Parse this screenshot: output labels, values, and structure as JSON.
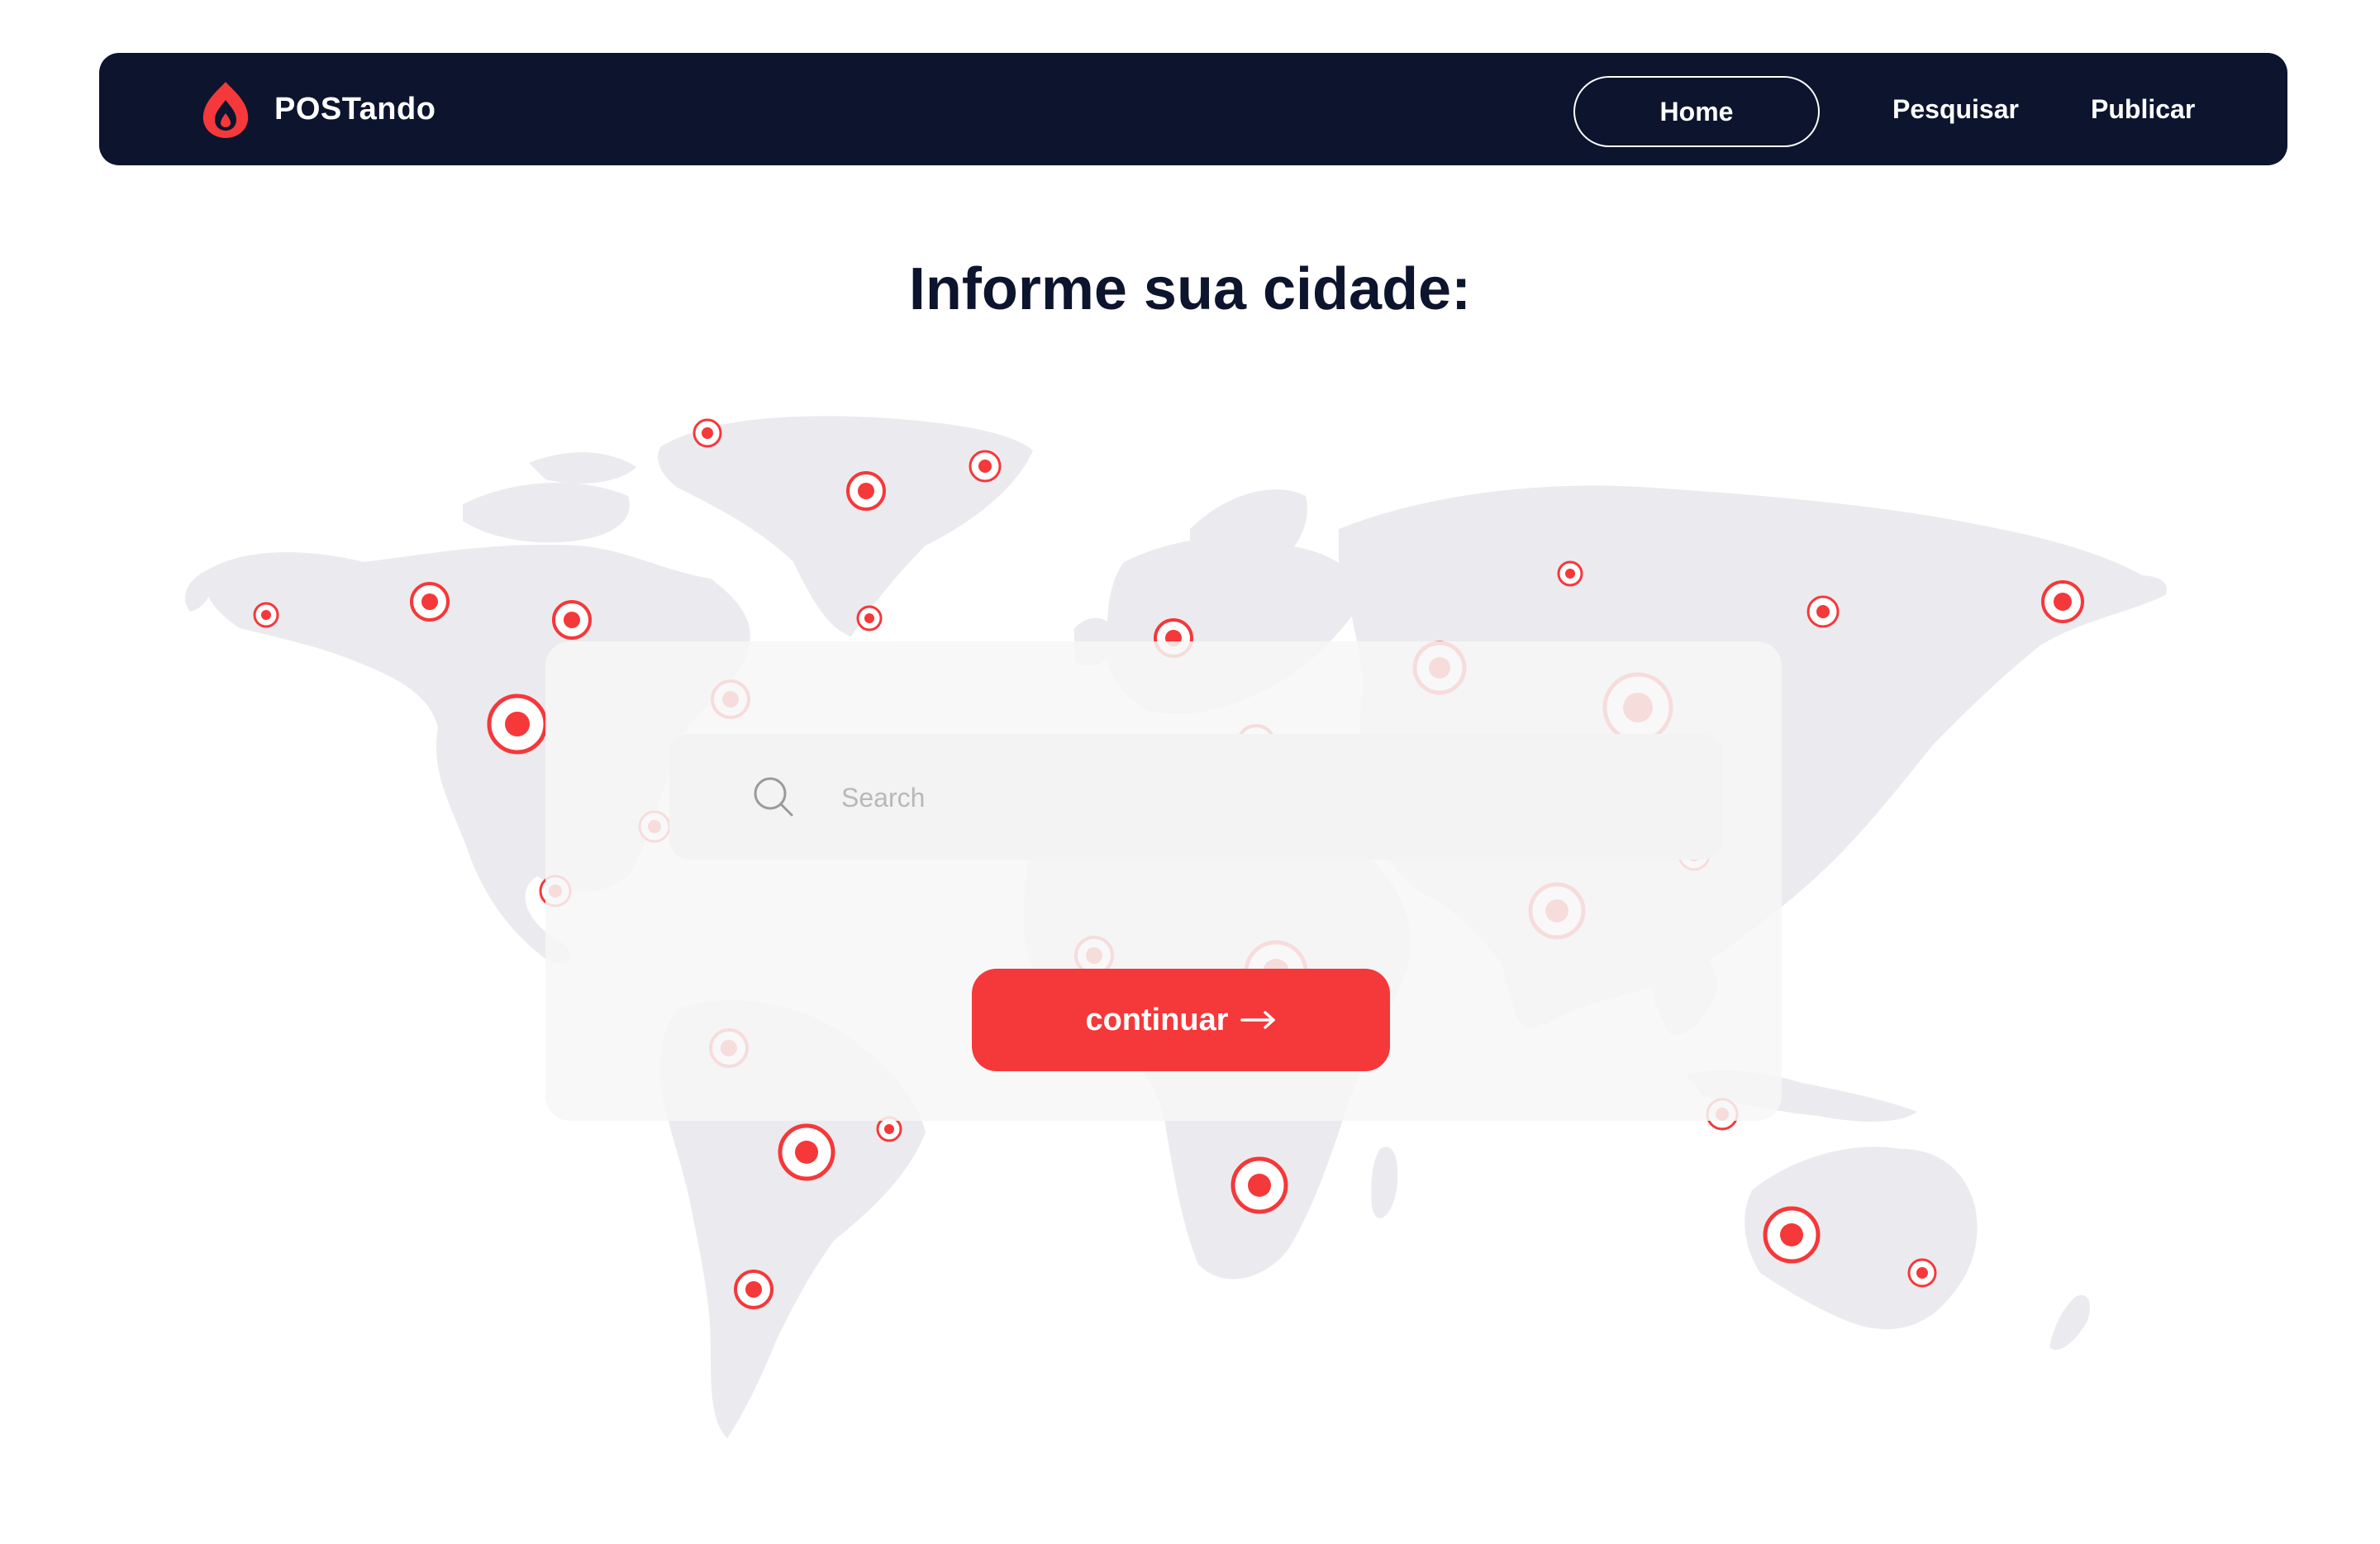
{
  "brand": {
    "name": "POSTando",
    "accent_color": "#f5383a",
    "navbar_color": "#0c142e"
  },
  "nav": {
    "home_label": "Home",
    "search_label": "Pesquisar",
    "publish_label": "Publicar"
  },
  "main": {
    "title": "Informe sua cidade:",
    "search": {
      "placeholder": "Search",
      "value": ""
    },
    "continue_label": "continuar"
  },
  "icons": {
    "logo": "flame-logo-icon",
    "search": "search-icon",
    "continue": "arrow-right-icon",
    "map_marker": "location-pin-icon"
  }
}
